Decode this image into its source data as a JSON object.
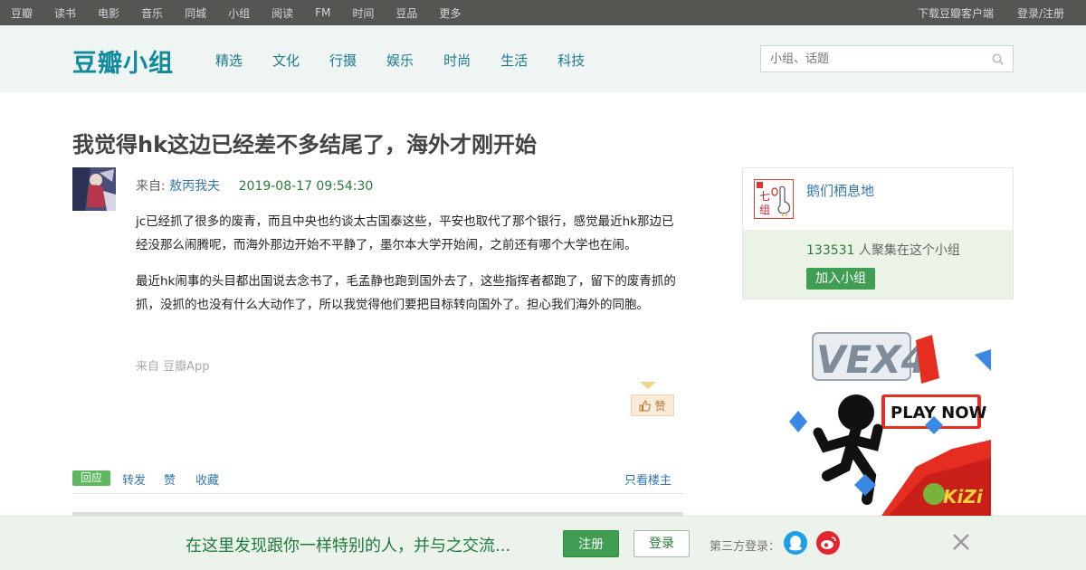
{
  "topbar": {
    "left": [
      "豆瓣",
      "读书",
      "电影",
      "音乐",
      "同城",
      "小组",
      "阅读",
      "FM",
      "时间",
      "豆品",
      "更多"
    ],
    "download": "下载豆瓣客户端",
    "login": "登录/注册"
  },
  "header": {
    "logo": "豆瓣小组",
    "nav": [
      "精选",
      "文化",
      "行摄",
      "娱乐",
      "时尚",
      "生活",
      "科技"
    ],
    "search_placeholder": "小组、话题"
  },
  "post": {
    "title": "我觉得hk这边已经差不多结尾了，海外才刚开始",
    "from_label": "来自:",
    "author": "敖丙我夫",
    "time": "2019-08-17 09:54:30",
    "paragraphs": [
      "jc已经抓了很多的废青，而且中央也约谈太古国泰这些，平安也取代了那个银行，感觉最近hk那边已经没那么闹腾呢，而海外那边开始不平静了，墨尔本大学开始闹，之前还有哪个大学也在闹。",
      "最近hk闹事的头目都出国说去念书了，毛孟静也跑到国外去了，这些指挥者都跑了，留下的废青抓的抓，没抓的也没有什么大动作了，所以我觉得他们要把目标转向国外了。担心我们海外的同胞。"
    ],
    "source": "来自 豆瓣App",
    "like_label": "赞"
  },
  "actions": {
    "reply": "回应",
    "forward": "转发",
    "like": "赞",
    "collect": "收藏",
    "owner_only": "只看楼主"
  },
  "group": {
    "name": "鹅们栖息地",
    "icon_text": "七组",
    "member_count": "133531",
    "member_suffix": " 人聚集在这个小组",
    "join": "加入小组"
  },
  "ad": {
    "close_glyphs": "ⓘ ✕",
    "game_title": "VEX4",
    "play_now": "PLAY NOW",
    "brand": "KiZi"
  },
  "bottombar": {
    "slogan": "在这里发现跟你一样特别的人，并与之交流...",
    "register": "注册",
    "login": "登录",
    "third_party": "第三方登录："
  },
  "colors": {
    "topbar": "#545652",
    "header_bg": "#eef5f2",
    "logo": "#118a9c",
    "link": "#3377aa",
    "green_button": "#3f9e54"
  }
}
